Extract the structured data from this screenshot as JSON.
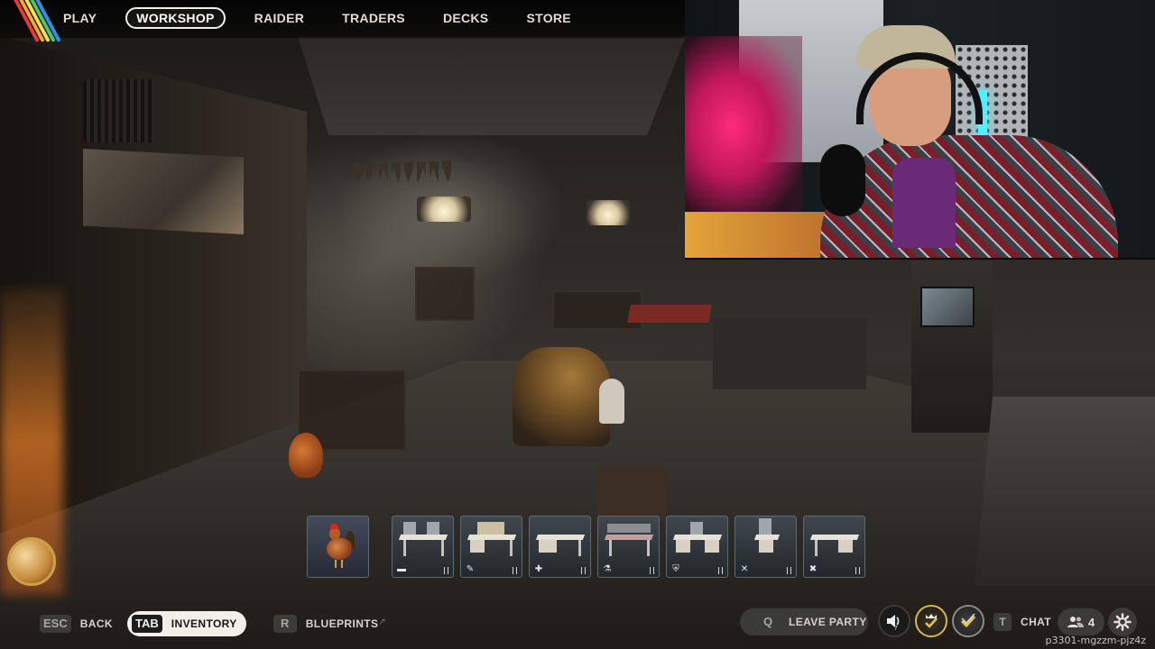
{
  "nav": {
    "items": [
      {
        "label": "PLAY",
        "active": false
      },
      {
        "label": "WORKSHOP",
        "active": true
      },
      {
        "label": "RAIDER",
        "active": false
      },
      {
        "label": "TRADERS",
        "active": false
      },
      {
        "label": "DECKS",
        "active": false
      },
      {
        "label": "STORE",
        "active": false
      }
    ]
  },
  "hotbar": {
    "slots": [
      {
        "name": "rooster",
        "icon": "rooster"
      },
      {
        "name": "workbench-1",
        "icon": "bed-icon"
      },
      {
        "name": "workbench-2",
        "icon": "wrench-icon"
      },
      {
        "name": "workbench-3",
        "icon": "plus-icon"
      },
      {
        "name": "workbench-4",
        "icon": "flask-icon"
      },
      {
        "name": "workbench-5",
        "icon": "shield-icon"
      },
      {
        "name": "workbench-6",
        "icon": "crossed-tools-icon"
      },
      {
        "name": "workbench-7",
        "icon": "crossed-swords-icon"
      }
    ]
  },
  "bottom": {
    "back": {
      "key": "ESC",
      "label": "BACK"
    },
    "inventory": {
      "key": "TAB",
      "label": "INVENTORY"
    },
    "blueprints": {
      "key": "R",
      "label": "BLUEPRINTS"
    },
    "leave_party": {
      "key": "Q",
      "label": "LEAVE PARTY"
    },
    "chat": {
      "key": "T",
      "label": "CHAT"
    },
    "party_count": "4"
  },
  "session_id": "p3301-mgzzm-pjz4z",
  "colors": {
    "accent_stripes": [
      "#e23b3b",
      "#f2a33a",
      "#f5e14a",
      "#4fc46a",
      "#2f8fe0"
    ],
    "active_pill": "#f2efe9",
    "crown_gold": "#d9b54a"
  }
}
